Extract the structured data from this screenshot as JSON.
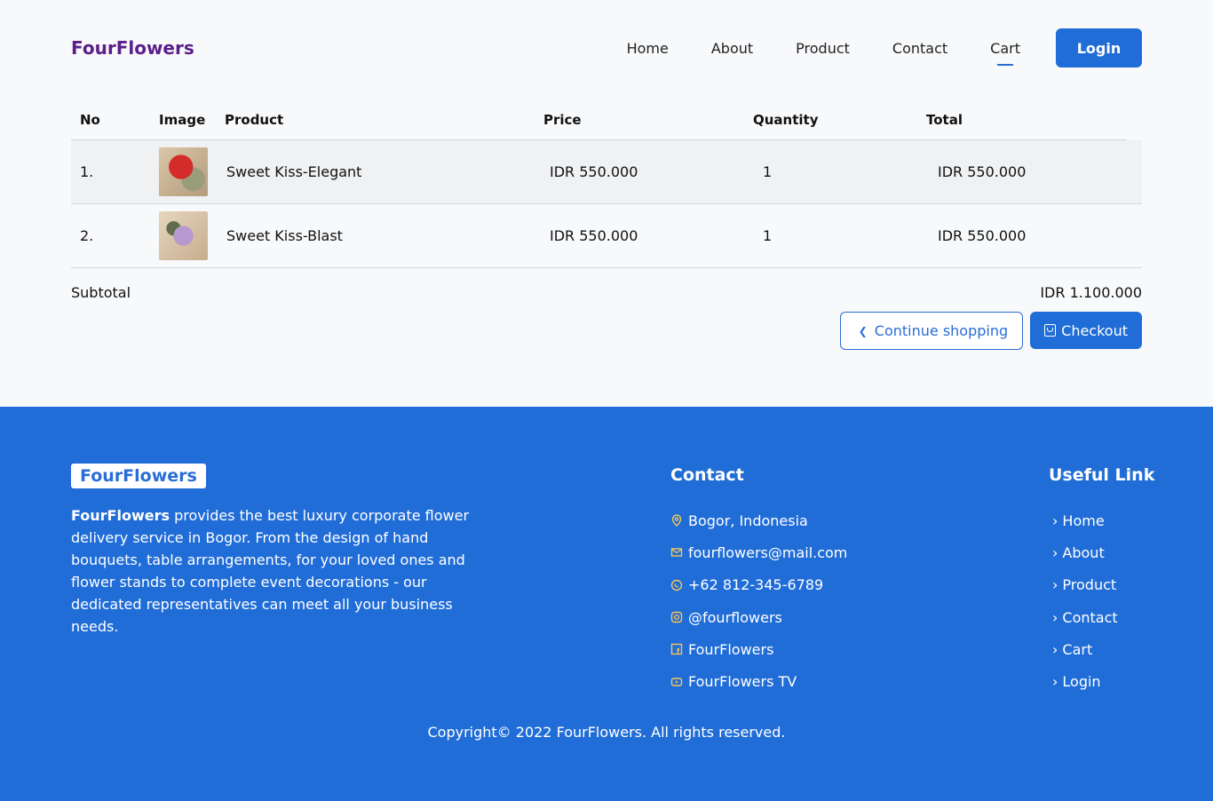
{
  "header": {
    "brand": "FourFlowers",
    "nav": [
      "Home",
      "About",
      "Product",
      "Contact",
      "Cart"
    ],
    "active_nav": "Cart",
    "login_label": "Login"
  },
  "cart": {
    "columns": [
      "No",
      "Image",
      "Product",
      "Price",
      "Quantity",
      "Total"
    ],
    "rows": [
      {
        "no": "1.",
        "product": "Sweet Kiss-Elegant",
        "price": "IDR 550.000",
        "qty": "1",
        "total": "IDR 550.000"
      },
      {
        "no": "2.",
        "product": "Sweet Kiss-Blast",
        "price": "IDR 550.000",
        "qty": "1",
        "total": "IDR 550.000"
      }
    ],
    "subtotal_label": "Subtotal",
    "subtotal_value": "IDR 1.100.000",
    "continue_label": "Continue shopping",
    "checkout_label": "Checkout"
  },
  "footer": {
    "brand": "FourFlowers",
    "desc_brand": "FourFlowers",
    "desc_text": " provides the best luxury corporate flower delivery service in Bogor. From the design of hand bouquets, table arrangements, for your loved ones and flower stands to complete event decorations - our dedicated representatives can meet all your business needs.",
    "contact_title": "Contact",
    "contact": [
      {
        "icon": "map-pin-icon",
        "text": "Bogor, Indonesia"
      },
      {
        "icon": "mail-icon",
        "text": "fourflowers@mail.com"
      },
      {
        "icon": "whatsapp-icon",
        "text": "+62 812-345-6789"
      },
      {
        "icon": "instagram-icon",
        "text": "@fourflowers"
      },
      {
        "icon": "facebook-icon",
        "text": "FourFlowers"
      },
      {
        "icon": "youtube-icon",
        "text": "FourFlowers TV"
      }
    ],
    "links_title": "Useful Link",
    "links": [
      "Home",
      "About",
      "Product",
      "Contact",
      "Cart",
      "Login"
    ],
    "copyright": "Copyright© 2022 FourFlowers. All rights reserved."
  },
  "colors": {
    "brand": "#5b1f8a",
    "primary": "#216dd7"
  }
}
